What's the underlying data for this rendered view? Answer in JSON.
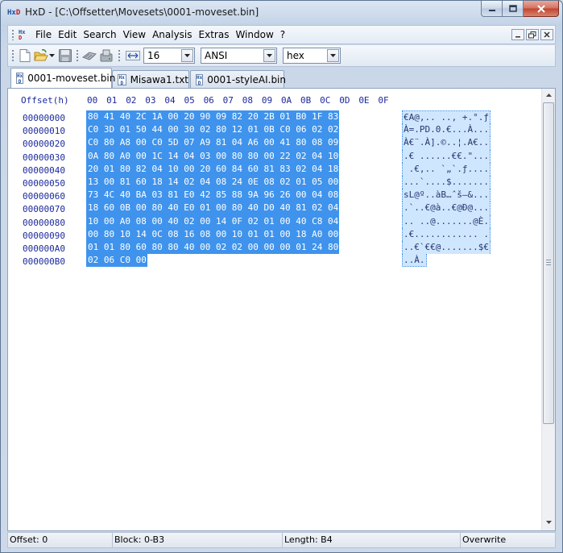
{
  "window": {
    "title": "HxD - [C:\\Offsetter\\Movesets\\0001-moveset.bin]",
    "icon_text_hx": "Hx",
    "icon_text_d": "D"
  },
  "menu": {
    "items": [
      "File",
      "Edit",
      "Search",
      "View",
      "Analysis",
      "Extras",
      "Window",
      "?"
    ]
  },
  "toolbar": {
    "bytes_per_row": "16",
    "charset": "ANSI",
    "offset_base": "hex"
  },
  "tabs": [
    {
      "label": "0001-moveset.bin",
      "active": true
    },
    {
      "label": "Misawa1.txt",
      "active": false
    },
    {
      "label": "0001-styleAI.bin",
      "active": false
    }
  ],
  "editor": {
    "offset_header": "Offset(h)",
    "columns": [
      "00",
      "01",
      "02",
      "03",
      "04",
      "05",
      "06",
      "07",
      "08",
      "09",
      "0A",
      "0B",
      "0C",
      "0D",
      "0E",
      "0F"
    ],
    "offsets": [
      "00000000",
      "00000010",
      "00000020",
      "00000030",
      "00000040",
      "00000050",
      "00000060",
      "00000070",
      "00000080",
      "00000090",
      "000000A0",
      "000000B0"
    ],
    "hex_rows": [
      "80 41 40 2C 1A 00 20 90 09 82 20 2B 01 B0 1F 83",
      "C0 3D 01 50 44 00 30 02 80 12 01 0B C0 06 02 02",
      "C0 80 A8 00 C0 5D 07 A9 81 04 A6 00 41 80 08 09",
      "0A 80 A0 00 1C 14 04 03 00 80 80 00 22 02 04 10",
      "20 01 80 82 04 10 00 20 60 84 60 81 83 02 04 18",
      "13 00 81 60 18 14 02 04 08 24 0E 08 02 01 05 00",
      "73 4C 40 BA 03 81 E0 42 85 88 9A 96 26 00 04 08",
      "18 60 0B 00 80 40 E0 01 00 80 40 D0 40 81 02 04",
      "10 00 A0 08 00 40 02 00 14 0F 02 01 00 40 C8 04",
      "00 80 10 14 0C 08 16 08 00 10 01 01 00 18 A0 00",
      "01 01 80 60 80 80 40 00 02 02 00 00 00 01 24 80",
      "02 06 C0 00"
    ],
    "ascii_rows": [
      "€A@,.. ..‚ +.°.ƒ",
      "À=.PD.0.€...À...",
      "À€¨.À].©..¦.A€..",
      ".€ ......€€.\"...",
      " .€‚.. `„`.ƒ....",
      "...`....$.......",
      "sL@º..àB…ˆš–&...",
      ".`..€@à..€@Ð@...",
      ".. ..@.......@È.",
      ".€............ .",
      "..€`€€@.......$€",
      "..À."
    ]
  },
  "status": {
    "offset": "Offset: 0",
    "block": "Block: 0-B3",
    "length": "Length: B4",
    "mode": "Overwrite"
  }
}
